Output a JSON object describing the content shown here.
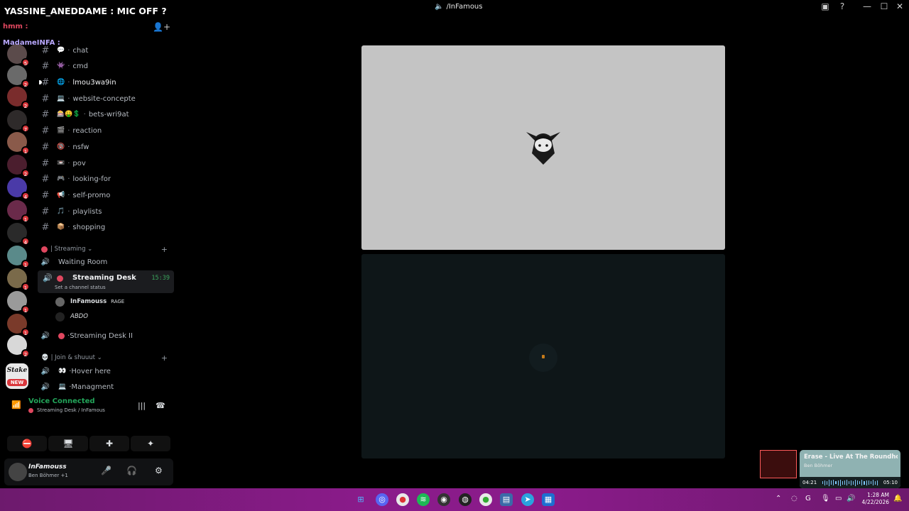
{
  "window": {
    "title": "/InFamous",
    "controls": [
      "▣",
      "?",
      "—",
      "☐",
      "✕"
    ]
  },
  "overlay": {
    "line1": "YASSINE_ANEDDAME : MIC OFF ?",
    "line2": "hmm :",
    "line3": "MadameINFA :"
  },
  "servers": [
    {
      "badge": "5"
    },
    {
      "badge": "2"
    },
    {
      "badge": "2"
    },
    {
      "badge": "7"
    },
    {
      "badge": "1"
    },
    {
      "badge": "2"
    },
    {
      "badge": "4"
    },
    {
      "badge": "1"
    },
    {
      "badge": "4"
    },
    {
      "badge": "1"
    },
    {
      "badge": "1"
    },
    {
      "badge": "1"
    },
    {
      "badge": "1"
    },
    {
      "badge": "2"
    }
  ],
  "new_server": {
    "label": "Stake",
    "badge": "NEW"
  },
  "channels": [
    {
      "emoji": "💬",
      "name": "chat"
    },
    {
      "emoji": "👾",
      "name": "cmd"
    },
    {
      "emoji": "🌐",
      "name": "lmou3wa9in"
    },
    {
      "emoji": "💻",
      "name": "website-concepte"
    },
    {
      "emoji": "🎰🤑💲",
      "name": "bets-wri9at"
    },
    {
      "emoji": "🎬",
      "name": "reaction"
    },
    {
      "emoji": "🔞",
      "name": "nsfw"
    },
    {
      "emoji": "📼",
      "name": "pov"
    },
    {
      "emoji": "🎮",
      "name": "looking-for"
    },
    {
      "emoji": "📢",
      "name": "self-promo"
    },
    {
      "emoji": "🎵",
      "name": "playlists"
    },
    {
      "emoji": "📦",
      "name": "shopping"
    }
  ],
  "streaming_category": {
    "label": "| Streaming",
    "waiting_room": "Waiting Room"
  },
  "active_voice": {
    "name": "Streaming Desk",
    "timer": "15:39",
    "status": "Set a channel status",
    "members": [
      {
        "name": "InFamouss",
        "tag": "RAGE"
      },
      {
        "name": "ABDO",
        "tag": ""
      }
    ]
  },
  "voice2": {
    "name": "Streaming Desk II"
  },
  "join_category": {
    "label": "| Join & shuuut"
  },
  "join_channels": [
    {
      "emoji": "👀",
      "name": "Hover here"
    },
    {
      "emoji": "💻",
      "name": "Managment"
    }
  ],
  "voice_panel": {
    "status": "Voice Connected",
    "location": "Streaming Desk / InFamous",
    "icons": [
      "camera-off",
      "screen-share",
      "activities",
      "soundboard"
    ]
  },
  "user": {
    "name": "InFamouss",
    "sub": "Ben Böhmer +1"
  },
  "music": {
    "track": "Erase - Live At The Roundhouse",
    "artist": "Ben Böhmer",
    "elapsed": "04:21",
    "total": "05:10",
    "progress": 0.84
  },
  "taskbar": {
    "time": "1:28 AM",
    "date": "4/22/2026"
  }
}
